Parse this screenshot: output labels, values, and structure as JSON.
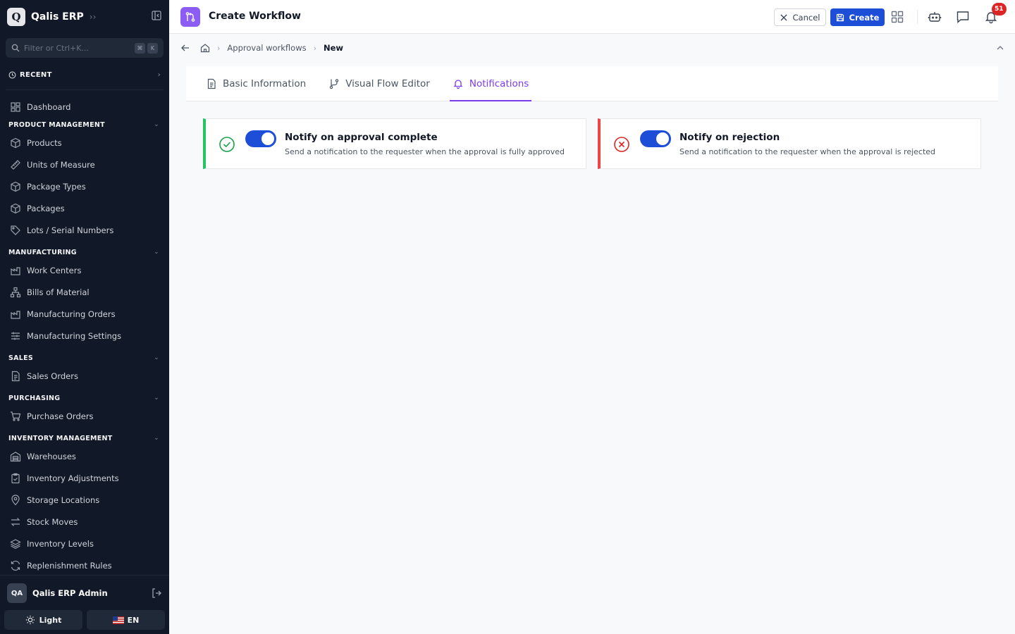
{
  "sidebar": {
    "brand_logo": "Q",
    "brand_name": "Qalis ERP",
    "filter_placeholder": "Filter or Ctrl+K...",
    "kbd_cmd": "⌘",
    "kbd_k": "K",
    "recent_label": "RECENT",
    "dashboard": "Dashboard",
    "sections": {
      "product": "PRODUCT MANAGEMENT",
      "manufacturing": "MANUFACTURING",
      "sales": "SALES",
      "purchasing": "PURCHASING",
      "inventory": "INVENTORY MANAGEMENT"
    },
    "product_items": [
      "Products",
      "Units of Measure",
      "Package Types",
      "Packages",
      "Lots / Serial Numbers"
    ],
    "manufacturing_items": [
      "Work Centers",
      "Bills of Material",
      "Manufacturing Orders",
      "Manufacturing Settings"
    ],
    "sales_items": [
      "Sales Orders"
    ],
    "purchasing_items": [
      "Purchase Orders"
    ],
    "inventory_items": [
      "Warehouses",
      "Inventory Adjustments",
      "Storage Locations",
      "Stock Moves",
      "Inventory Levels",
      "Replenishment Rules"
    ],
    "user_initials": "QA",
    "user_name": "Qalis ERP Admin",
    "theme_label": "Light",
    "lang_label": "EN"
  },
  "topbar": {
    "title": "Create Workflow",
    "cancel_label": "Cancel",
    "create_label": "Create",
    "notification_count": "51"
  },
  "breadcrumb": {
    "parent": "Approval workflows",
    "current": "New"
  },
  "tabs": {
    "basic": "Basic Information",
    "visual": "Visual Flow Editor",
    "notifications": "Notifications"
  },
  "cards": {
    "approval": {
      "title": "Notify on approval complete",
      "desc": "Send a notification to the requester when the approval is fully approved",
      "enabled": true
    },
    "rejection": {
      "title": "Notify on rejection",
      "desc": "Send a notification to the requester when the approval is rejected",
      "enabled": true
    }
  },
  "colors": {
    "accent": "#7c3aed",
    "primary": "#1d4ed8",
    "success": "#22c55e",
    "danger": "#ef4444",
    "sidebar_bg": "#111827"
  }
}
